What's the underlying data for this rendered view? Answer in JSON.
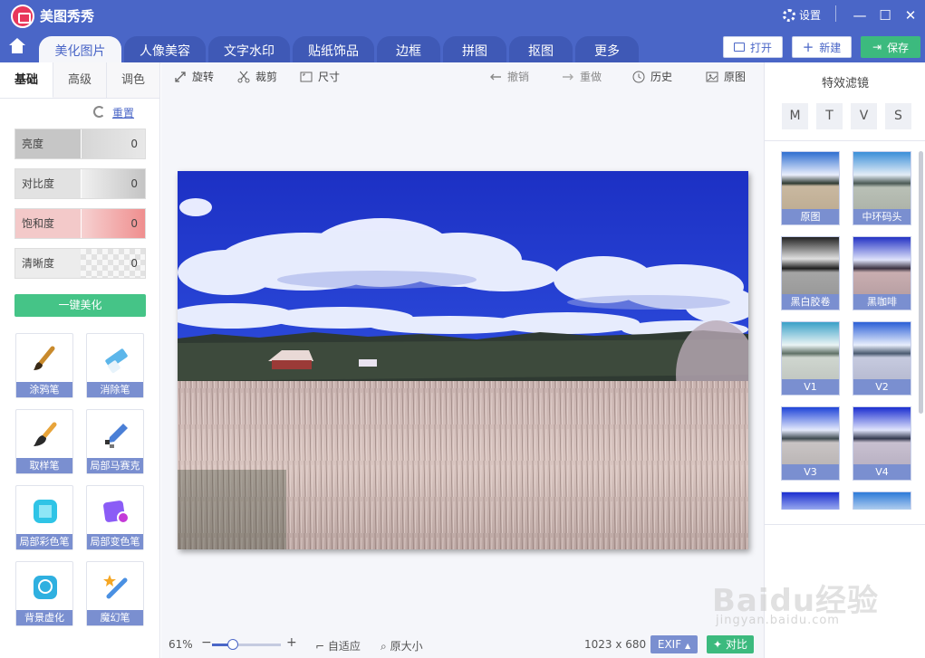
{
  "app": {
    "title": "美图秀秀",
    "settings_label": "设置"
  },
  "tabs": [
    {
      "label": "美化图片",
      "active": true
    },
    {
      "label": "人像美容",
      "active": false
    },
    {
      "label": "文字水印",
      "active": false
    },
    {
      "label": "贴纸饰品",
      "active": false
    },
    {
      "label": "边框",
      "active": false
    },
    {
      "label": "拼图",
      "active": false
    },
    {
      "label": "抠图",
      "active": false
    },
    {
      "label": "更多",
      "active": false
    }
  ],
  "header_buttons": {
    "open": "打开",
    "new": "新建",
    "save": "保存"
  },
  "left_panel": {
    "subtabs": [
      "基础",
      "高级",
      "调色"
    ],
    "reset_label": "重置",
    "adjustments": [
      {
        "label": "亮度",
        "value": "0"
      },
      {
        "label": "对比度",
        "value": "0"
      },
      {
        "label": "饱和度",
        "value": "0"
      },
      {
        "label": "清晰度",
        "value": "0"
      }
    ],
    "onekey_label": "一键美化",
    "tools": [
      "涂鸦笔",
      "消除笔",
      "取样笔",
      "局部马赛克",
      "局部彩色笔",
      "局部变色笔",
      "背景虚化",
      "魔幻笔"
    ]
  },
  "toolbar": {
    "rotate": "旋转",
    "crop": "裁剪",
    "size": "尺寸",
    "undo": "撤销",
    "redo": "重做",
    "history": "历史",
    "original": "原图"
  },
  "bottom": {
    "zoom": "61%",
    "zoom_level": 0.3,
    "fit": "自适应",
    "actual": "原大小",
    "dimensions": "1023 x 680",
    "exif": "EXIF",
    "compare": "对比"
  },
  "right_panel": {
    "title": "特效滤镜",
    "categories": [
      "M",
      "T",
      "V",
      "S"
    ],
    "filters": [
      "原图",
      "中环码头",
      "黑白胶卷",
      "黑咖啡",
      "V1",
      "V2",
      "V3",
      "V4"
    ]
  },
  "watermark": {
    "main": "Baidu经验",
    "sub": "jingyan.baidu.com"
  }
}
